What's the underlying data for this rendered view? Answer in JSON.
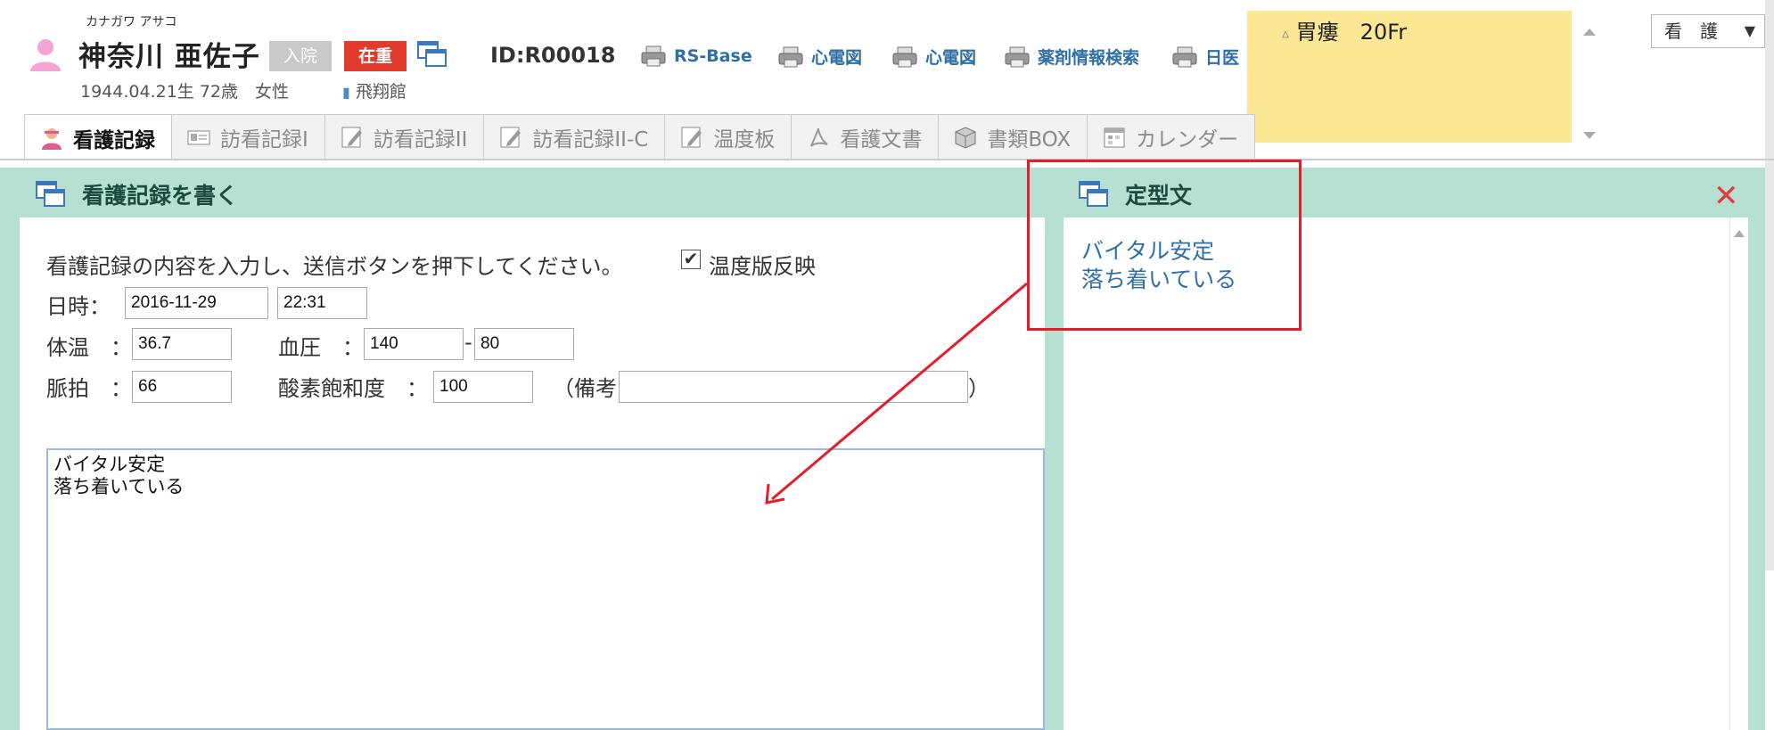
{
  "patient": {
    "kana": "カナガワ アサコ",
    "name": "神奈川 亜佐子",
    "badge_admission": "入院",
    "badge_severity": "在重",
    "birth_info": "1944.04.21生 72歳　女性",
    "facility": "飛翔館",
    "id": "ID:R00018"
  },
  "header_links": [
    "RS-Base",
    "心電図",
    "心電図",
    "薬剤情報検索",
    "日医"
  ],
  "memo": {
    "text": "胃瘻　20Fr"
  },
  "role_select": {
    "value": "看　護",
    "arrow": "▼"
  },
  "tabs": [
    {
      "label": "看護記録",
      "icon": "nurse-icon"
    },
    {
      "label": "訪看記録I",
      "icon": "card-icon"
    },
    {
      "label": "訪看記録II",
      "icon": "edit-icon"
    },
    {
      "label": "訪看記録II-C",
      "icon": "edit-icon"
    },
    {
      "label": "温度板",
      "icon": "edit-icon"
    },
    {
      "label": "看護文書",
      "icon": "pdf-icon"
    },
    {
      "label": "書類BOX",
      "icon": "box-icon"
    },
    {
      "label": "カレンダー",
      "icon": "calendar-icon"
    }
  ],
  "left_panel": {
    "title": "看護記録を書く",
    "instruction": "看護記録の内容を入力し、送信ボタンを押下してください。",
    "reflect_checkbox_label": "温度版反映",
    "reflect_checked": "✔",
    "datetime_label": "日時：",
    "date_value": "2016-11-29",
    "time_value": "22:31",
    "temp_label": "体温　：",
    "temp_value": "36.7",
    "bp_label": "血圧　：",
    "bp_high": "140",
    "bp_sep": "-",
    "bp_low": "80",
    "pulse_label": "脈拍　：",
    "pulse_value": "66",
    "spo2_label": "酸素飽和度　：",
    "spo2_value": "100",
    "note_open": "（備考",
    "note_close": "）",
    "note_value": "",
    "record_text": "バイタル安定\n落ち着いている"
  },
  "right_panel": {
    "title": "定型文",
    "templates": [
      "バイタル安定",
      "落ち着いている"
    ]
  },
  "colors": {
    "panel_bg": "#b6e0d2",
    "memo_bg": "#fce795",
    "link": "#2f6fa8",
    "highlight_red": "#e31e2a"
  }
}
